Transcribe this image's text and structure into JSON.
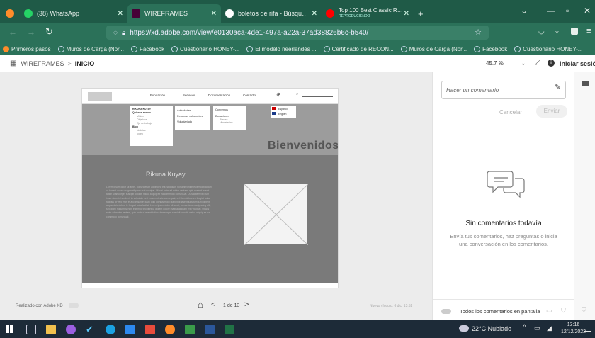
{
  "browser": {
    "tabs": [
      {
        "label": "(38) WhatsApp",
        "icon": "whatsapp-icon",
        "color": "#25d366"
      },
      {
        "label": "WIREFRAMES",
        "icon": "adobe-xd-icon",
        "color": "#470137",
        "active": true
      },
      {
        "label": "boletos de rifa - Búsqueda de G",
        "icon": "google-icon",
        "color": "#ffffff"
      },
      {
        "label": "Top 100 Best Classic Rock Song",
        "sublabel": "REPRODUCIENDO",
        "icon": "youtube-icon",
        "color": "#ff0000"
      }
    ],
    "new_tab": "+",
    "url": "https://xd.adobe.com/view/e0130aca-4de1-497a-a22a-37ad38826b6c-b540/",
    "bookmarks": [
      "Primeros pasos",
      "Muros de Carga (Nor...",
      "Facebook",
      "Cuestionario HONEY-...",
      "El modelo neerlandés ...",
      "Certificado de RECON...",
      "Muros de Carga (Nor...",
      "Facebook",
      "Cuestionario HONEY-..."
    ]
  },
  "xd": {
    "breadcrumb_root": "WIREFRAMES",
    "breadcrumb_sep": ">",
    "breadcrumb_current": "INICIO",
    "zoom": "45.7 %",
    "signin": "Iniciar sesión",
    "made_with": "Realizado con Adobe XD",
    "pager": "1 de 13",
    "last_saved": "Nuevo vínculo: 6 dic, 13:52"
  },
  "wireframe": {
    "nav": [
      "Fundación",
      "Servicios",
      "Documentación",
      "Contacto"
    ],
    "menu_col1_title": "RIKUNA KUYAY",
    "menu_col1_items": [
      "Quienes somos",
      "Misión",
      "Objetivos",
      "Eje de trabajo",
      "Blog",
      "Noticias",
      "Video"
    ],
    "menu_col2_items": [
      "Actividades",
      "Personas vulnerables",
      "Voluntariado"
    ],
    "menu_col3_items": [
      "Convenios",
      "Donaciones",
      "Bienes",
      "Monetarias"
    ],
    "lang": [
      "Español",
      "English"
    ],
    "hero_title": "Bienvenidos",
    "section_title": "Rikuna Kuyay",
    "lorem": "Lorem ipsum dolor sit amet, consectetuer adipiscing elit, sed diam nonummy nibh euismod tincidunt ut laoreet dolore magna aliquam erat volutpat. Ut wisi enim ad minim veniam, quis nostrud exerci tation ullamcorper suscipit lobortis nisl ut aliquip ex ea commodo consequat. Duis autem vel eum iriure dolor in hendrerit in vulputate velit esse molestie consequat, vel illum dolore eu feugiat nulla facilisis at vero eros et accumsan et iusto odio dignissim qui blandit praesent luptatum zzril delenit augue duis dolore te feugait nulla facilisi. Lorem ipsum dolor sit amet, cons ectetuer adipiscing elit, sed diam nonummy nibh euismod tincidunt ut laoreet dolore magna aliquam erat volutpat. Ut wisi enim ad minim veniam, quis nostrud exerci tation ullamcorper suscipit lobortis nisl ut aliquip ex ea commodo consequat."
  },
  "comments": {
    "placeholder": "Hacer un comentario",
    "cancel": "Cancelar",
    "send": "Enviar",
    "empty_title": "Sin comentarios todavía",
    "empty_body": "Envía tus comentarios, haz preguntas o inicia una conversación en los comentarios.",
    "footer": "Todos los comentarios en pantalla"
  },
  "taskbar": {
    "weather": "22°C  Nublado",
    "time": "13:16",
    "date": "12/12/2022"
  }
}
